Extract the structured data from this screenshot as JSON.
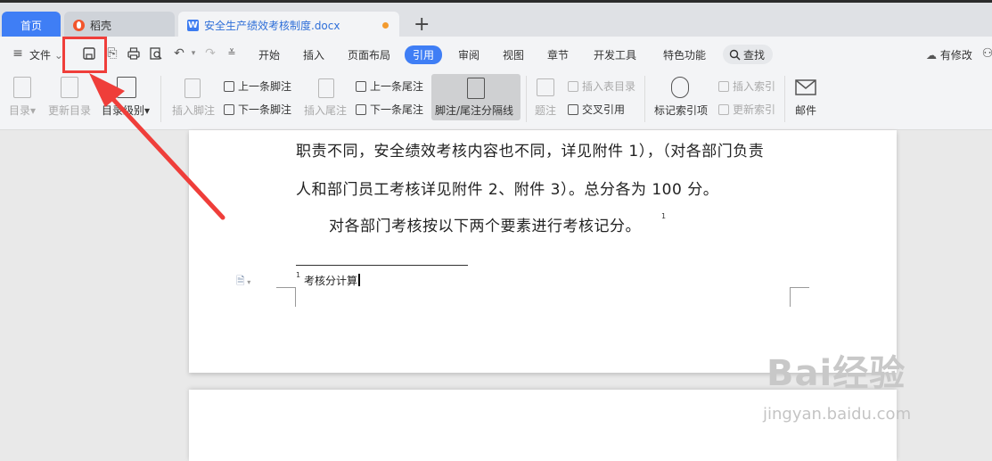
{
  "tabs": [
    {
      "label": "首页"
    },
    {
      "label": "稻壳"
    },
    {
      "label": "安全生产绩效考核制度.docx"
    }
  ],
  "menu": {
    "file_label": "文件",
    "items": [
      "开始",
      "插入",
      "页面布局",
      "引用",
      "审阅",
      "视图",
      "章节",
      "开发工具",
      "特色功能"
    ],
    "active": "引用",
    "search_label": "查找",
    "right_label": "有修改"
  },
  "ribbon": {
    "toc": "目录",
    "update_toc": "更新目录",
    "toc_level": "目录级别",
    "insert_footnote": "插入脚注",
    "prev_footnote": "上一条脚注",
    "next_footnote": "下一条脚注",
    "insert_endnote": "插入尾注",
    "prev_endnote": "上一条尾注",
    "next_endnote": "下一条尾注",
    "separator": "脚注/尾注分隔线",
    "caption": "题注",
    "insert_table_of_figures": "插入表目录",
    "cross_ref": "交叉引用",
    "mark_index": "标记索引项",
    "insert_index": "插入索引",
    "update_index": "更新索引",
    "mail": "邮件"
  },
  "document": {
    "line1": "职责不同，安全绩效考核内容也不同，详见附件 1），（对各部门负责",
    "line2": "人和部门员工考核详见附件 2、附件 3）。总分各为 100 分。",
    "line3": "对各部门考核按以下两个要素进行考核记分。",
    "footnote_mark": "1",
    "footnote_text": "考核分计算"
  },
  "watermark": {
    "brand": "Bai经验",
    "url": "jingyan.baidu.com"
  },
  "colors": {
    "accent": "#3f7ef5",
    "annotation": "#ef3e3a"
  }
}
